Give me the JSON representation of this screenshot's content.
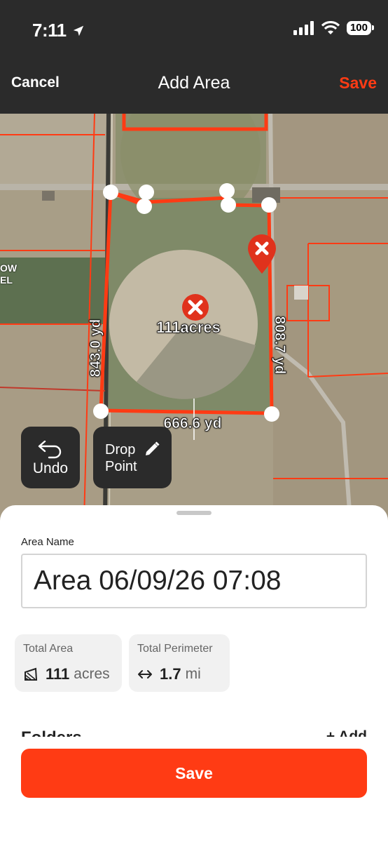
{
  "status_bar": {
    "time": "7:11",
    "battery": "100"
  },
  "nav": {
    "cancel": "Cancel",
    "title": "Add Area",
    "save": "Save"
  },
  "map": {
    "area_label": "111acres",
    "measurements": {
      "west": "843.0 yd",
      "east": "808.7 yd",
      "south": "666.6 yd"
    },
    "partial_label": "OW\nEL",
    "accent_color": "#ff3b14"
  },
  "controls": {
    "undo": "Undo",
    "drop_point_line1": "Drop",
    "drop_point_line2": "Point"
  },
  "form": {
    "area_name_label": "Area Name",
    "area_name_value": "Area 06/09/26 07:08",
    "total_area_label": "Total Area",
    "total_area_value": "111",
    "total_area_unit": "acres",
    "total_perimeter_label": "Total Perimeter",
    "total_perimeter_value": "1.7",
    "total_perimeter_unit": "mi",
    "folders_label": "Folders",
    "add_label": "+ Add",
    "save_button": "Save"
  }
}
